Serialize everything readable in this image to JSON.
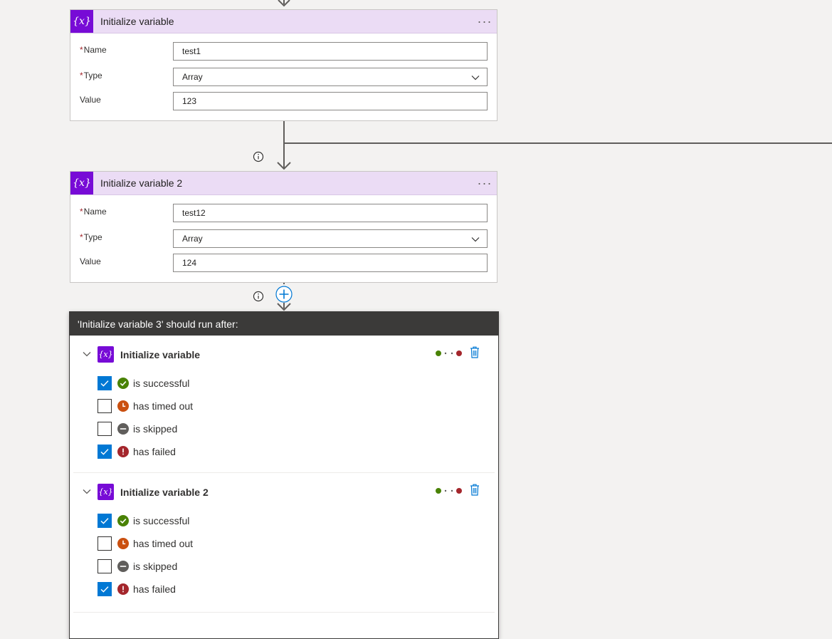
{
  "actions": [
    {
      "title": "Initialize variable",
      "more": "···",
      "fields": [
        {
          "label": "Name",
          "required": true,
          "value": "test1"
        },
        {
          "label": "Type",
          "required": true,
          "value": "Array"
        },
        {
          "label": "Value",
          "required": false,
          "value": "123"
        }
      ]
    },
    {
      "title": "Initialize variable 2",
      "more": "···",
      "fields": [
        {
          "label": "Name",
          "required": true,
          "value": "test12"
        },
        {
          "label": "Type",
          "required": true,
          "value": "Array"
        },
        {
          "label": "Value",
          "required": false,
          "value": "124"
        }
      ]
    }
  ],
  "var_icon_glyph": "{x}",
  "required_mark": "*",
  "run_after": {
    "title": "'Initialize variable 3' should run after:",
    "groups": [
      {
        "name": "Initialize variable",
        "options": [
          {
            "label": "is successful",
            "checked": true,
            "status": "success"
          },
          {
            "label": "has timed out",
            "checked": false,
            "status": "timedout"
          },
          {
            "label": "is skipped",
            "checked": false,
            "status": "skipped"
          },
          {
            "label": "has failed",
            "checked": true,
            "status": "failed"
          }
        ]
      },
      {
        "name": "Initialize variable 2",
        "options": [
          {
            "label": "is successful",
            "checked": true,
            "status": "success"
          },
          {
            "label": "has timed out",
            "checked": false,
            "status": "timedout"
          },
          {
            "label": "is skipped",
            "checked": false,
            "status": "skipped"
          },
          {
            "label": "has failed",
            "checked": true,
            "status": "failed"
          }
        ]
      }
    ]
  },
  "colors": {
    "variable_purple": "#770bd6",
    "header_lavender": "#ebdcf5",
    "checkbox_blue": "#0078d4",
    "success": "#498205",
    "timedout": "#ca5010",
    "skipped": "#605e5c",
    "failed": "#a4262c",
    "panel_header": "#3b3a39"
  }
}
